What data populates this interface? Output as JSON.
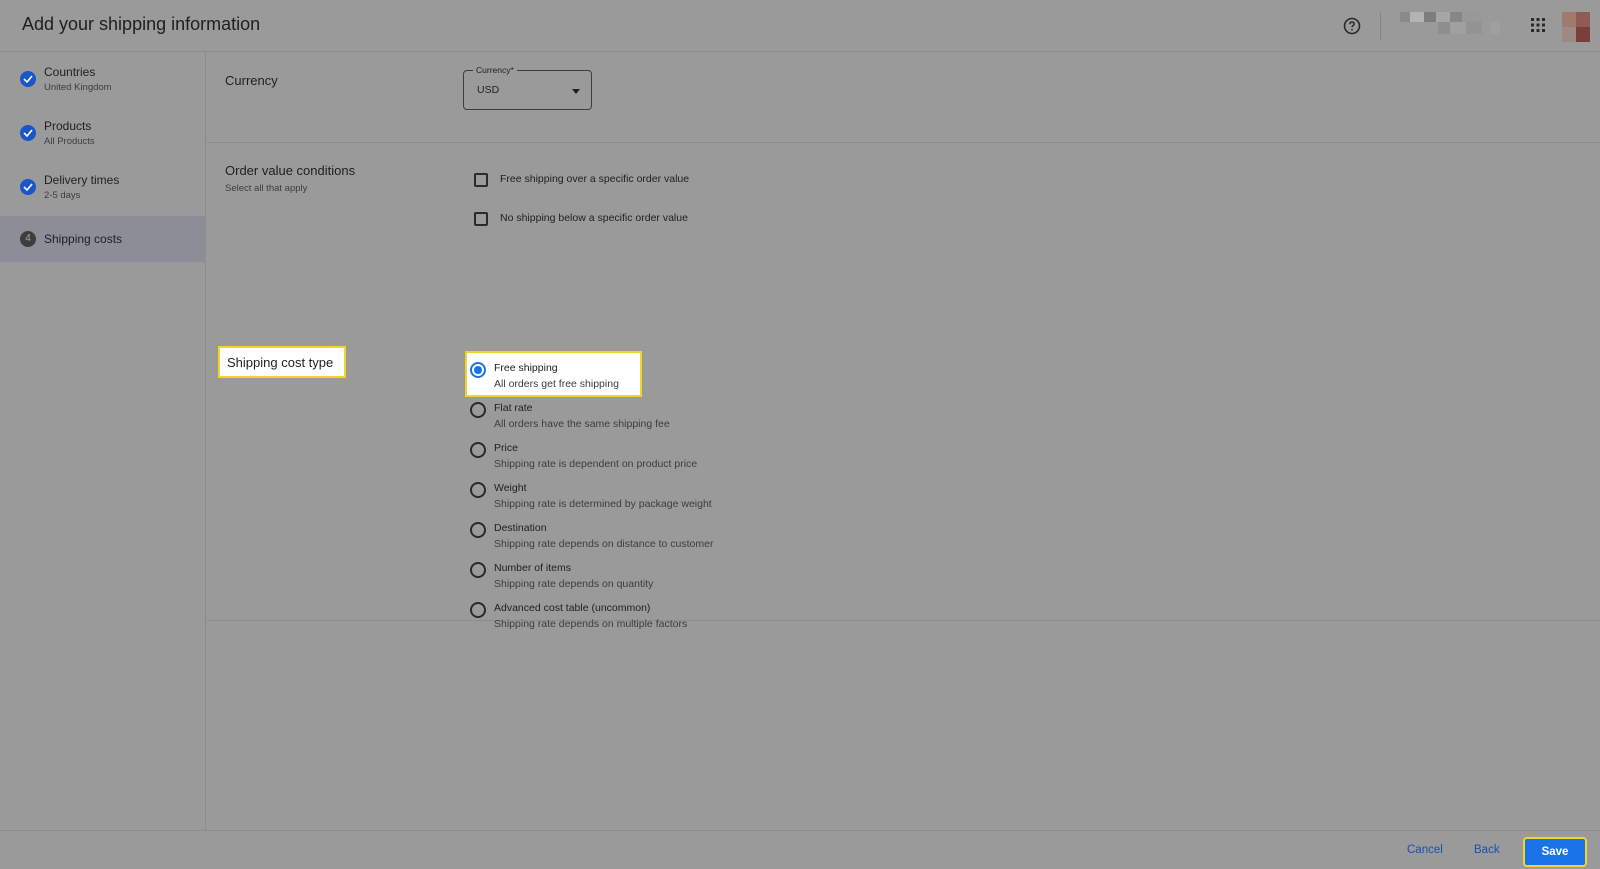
{
  "header": {
    "title": "Add your shipping information",
    "icons": [
      "help-icon",
      "apps-grid-icon"
    ]
  },
  "steps": [
    {
      "label": "Countries",
      "sub": "United Kingdom",
      "state": "done"
    },
    {
      "label": "Products",
      "sub": "All Products",
      "state": "done"
    },
    {
      "label": "Delivery times",
      "sub": "2-5 days",
      "state": "done"
    },
    {
      "label": "Shipping costs",
      "number": "4",
      "state": "active"
    }
  ],
  "currency": {
    "title": "Currency",
    "field_label": "Currency*",
    "value": "USD"
  },
  "order_conditions": {
    "title": "Order value conditions",
    "subtitle": "Select all that apply",
    "options": [
      {
        "label": "Free shipping over a specific order value",
        "checked": false
      },
      {
        "label": "No shipping below a specific order value",
        "checked": false
      }
    ]
  },
  "cost_type": {
    "title": "Shipping cost type",
    "options": [
      {
        "label": "Free shipping",
        "sub": "All orders get free shipping",
        "selected": true
      },
      {
        "label": "Flat rate",
        "sub": "All orders have the same shipping fee",
        "selected": false
      },
      {
        "label": "Price",
        "sub": "Shipping rate is dependent on product price",
        "selected": false
      },
      {
        "label": "Weight",
        "sub": "Shipping rate is determined by package weight",
        "selected": false
      },
      {
        "label": "Destination",
        "sub": "Shipping rate depends on distance to customer",
        "selected": false
      },
      {
        "label": "Number of items",
        "sub": "Shipping rate depends on quantity",
        "selected": false
      },
      {
        "label": "Advanced cost table (uncommon)",
        "sub": "Shipping rate depends on multiple factors",
        "selected": false
      }
    ]
  },
  "footer": {
    "cancel": "Cancel",
    "back": "Back",
    "save": "Save"
  },
  "colors": {
    "accent": "#1a73e8",
    "highlight": "#f2d42a",
    "overlay": "#9a9a9a"
  }
}
